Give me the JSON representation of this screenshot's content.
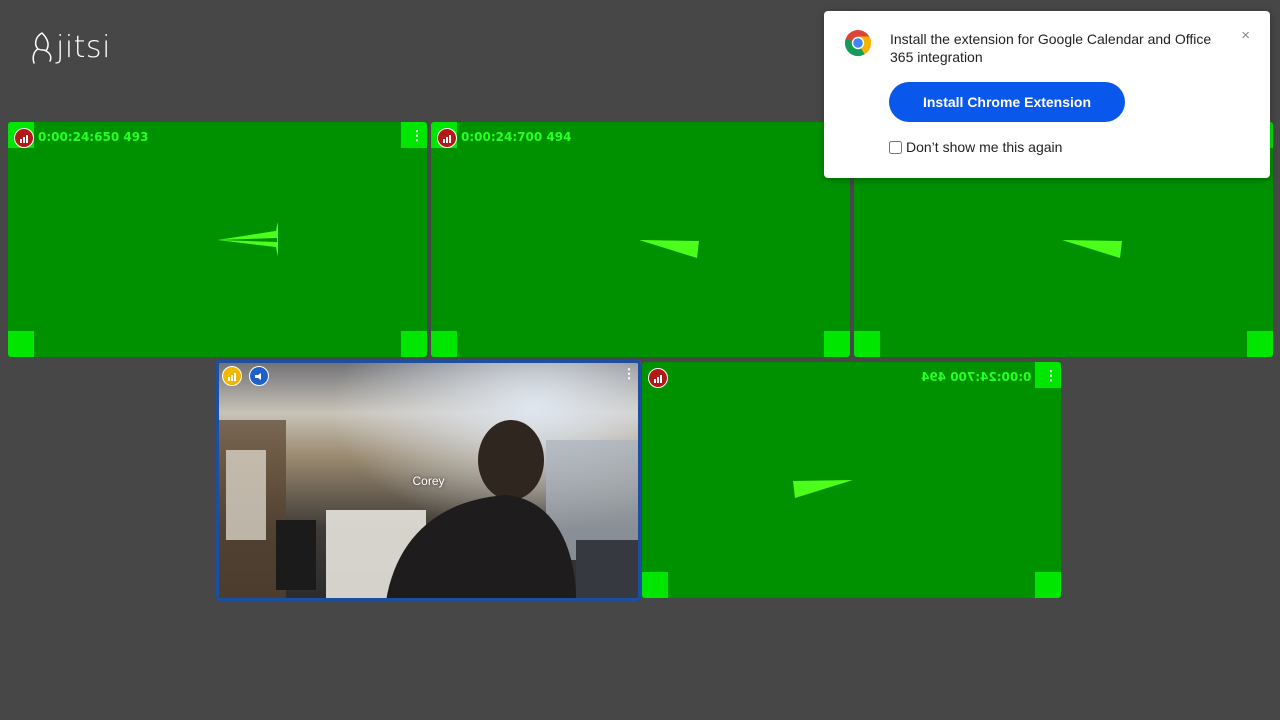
{
  "app": {
    "logo_text": "jitsi"
  },
  "tiles": [
    {
      "timestamp": "0:00:24:650 493"
    },
    {
      "timestamp": "0:00:24:700 494"
    },
    {
      "timestamp": ""
    },
    {
      "participant_name": "Corey"
    },
    {
      "timestamp": "0:00:24:700 494"
    }
  ],
  "extension_popup": {
    "message": "Install the extension for Google Calendar and Office 365 integration",
    "install_label": "Install Chrome Extension",
    "dont_show_label": "Don’t show me this again",
    "close_symbol": "×"
  },
  "colors": {
    "background": "#474747",
    "video_green": "#009100",
    "accent_blue": "#0a57eb",
    "indicator_red": "#b41818",
    "indicator_yellow": "#f2b705"
  }
}
